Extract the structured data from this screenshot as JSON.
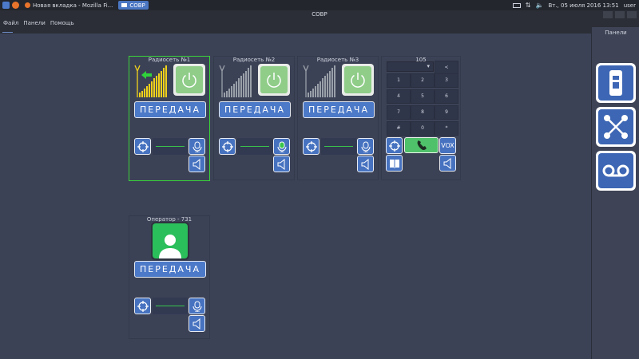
{
  "taskbar": {
    "tasks": [
      "Новая вкладка - Mozilla Fi...",
      "СОВР"
    ],
    "clock": "Вт., 05 июля 2016 13:51",
    "user": "user"
  },
  "window": {
    "title": "СОВР"
  },
  "menu": {
    "items": [
      "Файл",
      "Панели",
      "Помощь"
    ]
  },
  "right_panel": {
    "title": "Панели"
  },
  "radionets": [
    {
      "title": "Радиосеть №1",
      "ptt_label": "ПЕРЕДАЧА",
      "selected": true,
      "signal_color": "#f2d21b"
    },
    {
      "title": "Радиосеть №2",
      "ptt_label": "ПЕРЕДАЧА",
      "selected": false,
      "signal_color": "#9aa0a8"
    },
    {
      "title": "Радиосеть №3",
      "ptt_label": "ПЕРЕДАЧА",
      "selected": false,
      "signal_color": "#9aa0a8"
    }
  ],
  "dialpad": {
    "title": "105",
    "combo_value": "",
    "backspace": "<",
    "keys": [
      "1",
      "2",
      "3",
      "4",
      "5",
      "6",
      "7",
      "8",
      "9",
      "#",
      "0",
      "*"
    ],
    "vox_label": "VOX"
  },
  "operator": {
    "title": "Оператор - 731",
    "ptt_label": "ПЕРЕДАЧА"
  },
  "colors": {
    "accent": "#4c79c8",
    "selected_border": "#3ad13a",
    "level_line": "#39c44b",
    "call_green": "#4fc16a"
  }
}
